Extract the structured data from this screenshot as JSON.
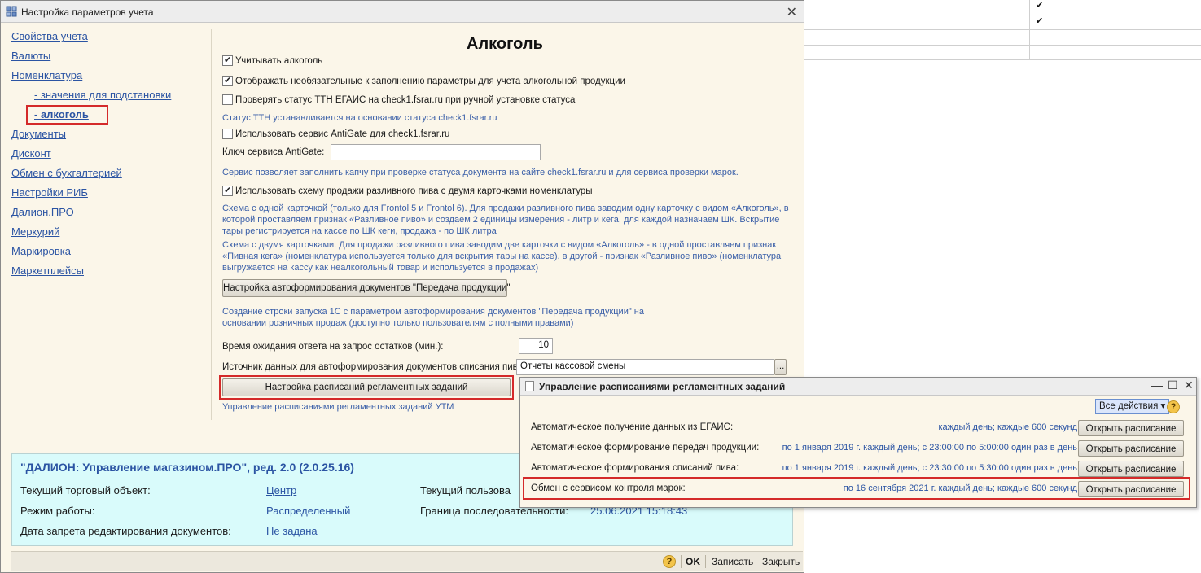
{
  "background_table": {
    "checks": [
      "✔",
      "✔"
    ]
  },
  "window": {
    "title": "Настройка параметров учета",
    "close_glyph": "✕"
  },
  "nav": {
    "items": [
      {
        "label": "Свойства учета"
      },
      {
        "label": "Валюты"
      },
      {
        "label": "Номенклатура"
      },
      {
        "label": "- значения для подстановки"
      },
      {
        "label": "- алкоголь"
      },
      {
        "label": "Документы"
      },
      {
        "label": "Дисконт"
      },
      {
        "label": "Обмен с бухгалтерией"
      },
      {
        "label": "Настройки РИБ"
      },
      {
        "label": "Далион.ПРО"
      },
      {
        "label": "Меркурий"
      },
      {
        "label": "Маркировка"
      },
      {
        "label": "Маркетплейсы"
      }
    ]
  },
  "content": {
    "title": "Алкоголь",
    "cb_track_alcohol": "Учитывать алкоголь",
    "cb_show_optional": "Отображать необязательные к заполнению параметры для учета алкогольной продукции",
    "cb_check_ttn": "Проверять статус ТТН ЕГАИС на check1.fsrar.ru при ручной установке статуса",
    "hint_ttn": "Статус ТТН устанавливается на основании статуса check1.fsrar.ru",
    "cb_antigate": "Использовать сервис AntiGate для check1.fsrar.ru",
    "antigate_key_label": "Ключ сервиса AntiGate:",
    "antigate_key_value": "",
    "hint_antigate": "Сервис позволяет заполнить капчу при проверке статуса документа на сайте check1.fsrar.ru и для сервиса проверки марок.",
    "cb_beer_two_cards": "Использовать схему продажи разливного пива с двумя карточками номенклатуры",
    "hint_one_card_1": "Схема с одной карточкой (только для Frontol 5 и Frontol 6). Для продажи разливного пива заводим одну карточку с видом «Алкоголь», в",
    "hint_one_card_2": "которой проставляем признак «Разливное пиво» и создаем 2 единицы измерения - литр и кега, для каждой назначаем ШК. Вскрытие",
    "hint_one_card_3": "тары регистрируется на кассе по ШК кеги, продажа - по ШК литра",
    "hint_two_cards_1": "Схема с двумя карточками. Для продажи разливного пива заводим две карточки с видом «Алкоголь» - в одной проставляем признак",
    "hint_two_cards_2": "«Пивная кега» (номенклатура используется только для вскрытия тары на кассе), в другой - признак «Разливное пиво» (номенклатура",
    "hint_two_cards_3": "выгружается на кассу как неалкогольный товар и используется в продажах)",
    "btn_autoform": "Настройка автоформирования документов \"Передача продукции\"",
    "hint_autoform_1": "Создание строки запуска 1С с параметром автоформирования документов \"Передача продукции\" на",
    "hint_autoform_2": "основании розничных продаж (доступно только пользователям с полными правами)",
    "wait_label": "Время ожидания ответа на запрос остатков (мин.):",
    "wait_value": "10",
    "source_label": "Источник данных для автоформирования документов списания пива:",
    "source_value": "Отчеты кассовой смены",
    "source_select_glyph": "...",
    "btn_schedules": "Настройка расписаний регламентных заданий",
    "hint_schedules": "Управление расписаниями регламентных заданий УТМ"
  },
  "info": {
    "title": "\"ДАЛИОН: Управление магазином.ПРО\", ред. 2.0 (2.0.25.16)",
    "store_label": "Текущий торговый объект:",
    "store_value": "Центр",
    "mode_label": "Режим работы:",
    "mode_value": "Распределенный",
    "lock_label": "Дата запрета редактирования документов:",
    "lock_value": "Не задана",
    "user_label": "Текущий пользова",
    "seq_label": "Граница последовательности:",
    "seq_value": "25.06.2021 15:18:43"
  },
  "bottom": {
    "help": "?",
    "ok": "OK",
    "save": "Записать",
    "close": "Закрыть"
  },
  "popup": {
    "title": "Управление расписаниями регламентных заданий",
    "minimize_glyph": "—",
    "maximize_glyph": "☐",
    "close_glyph": "✕",
    "all_actions": "Все действия ▾",
    "help": "?",
    "tasks": [
      {
        "name": "Автоматическое получение данных из ЕГАИС:",
        "schedule": "каждый день; каждые 600 секунд",
        "button": "Открыть расписание"
      },
      {
        "name": "Автоматическое формирование передач продукции:",
        "schedule": "по 1 января 2019 г. каждый день; с 23:00:00 по 5:00:00 один раз в день",
        "button": "Открыть расписание"
      },
      {
        "name": "Автоматическое формирования списаний пива:",
        "schedule": "по 1 января 2019 г. каждый день; с 23:30:00 по 5:30:00 один раз в день",
        "button": "Открыть расписание"
      },
      {
        "name": "Обмен с сервисом контроля марок:",
        "schedule": "по 16 сентября 2021 г. каждый день; каждые 600 секунд",
        "button": "Открыть расписание"
      }
    ]
  },
  "colors": {
    "link": "#2b54a3",
    "highlight": "#d42a2a",
    "window_bg": "#fbf6e9",
    "info_bg": "#d9fbfb"
  }
}
